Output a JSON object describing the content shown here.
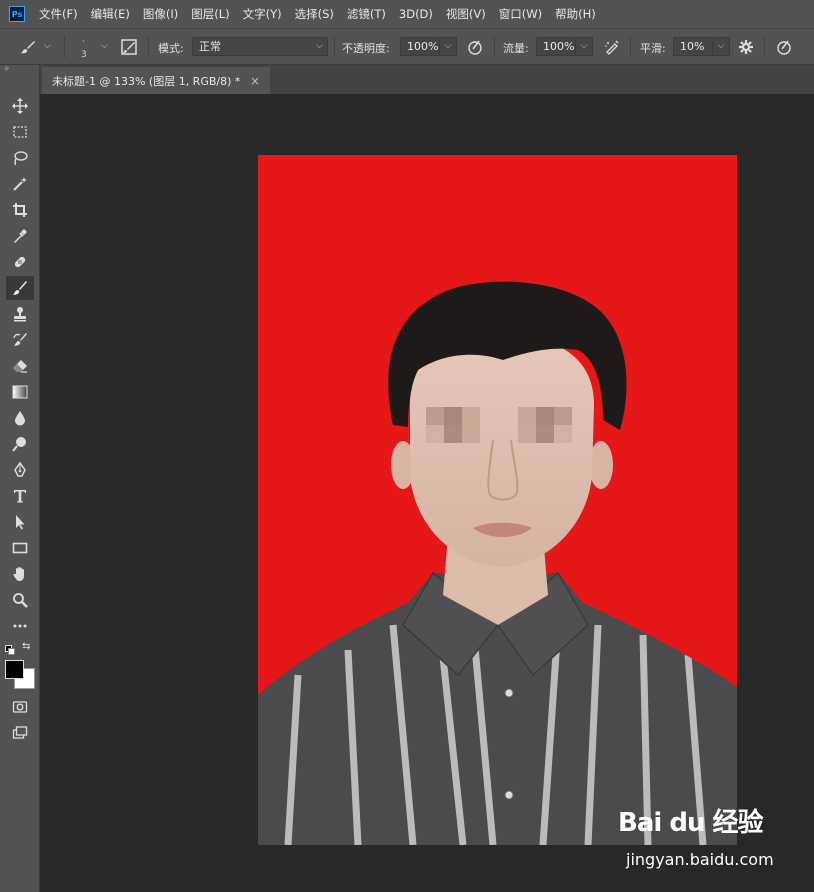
{
  "app": {
    "logo": "Ps"
  },
  "menu": [
    "文件(F)",
    "编辑(E)",
    "图像(I)",
    "图层(L)",
    "文字(Y)",
    "选择(S)",
    "滤镜(T)",
    "3D(D)",
    "视图(V)",
    "窗口(W)",
    "帮助(H)"
  ],
  "options": {
    "brush_size": "3",
    "mode_label": "模式:",
    "mode_value": "正常",
    "opacity_label": "不透明度:",
    "opacity_value": "100%",
    "flow_label": "流量:",
    "flow_value": "100%",
    "smoothing_label": "平滑:",
    "smoothing_value": "10%"
  },
  "document_tab": {
    "title": "未标题-1 @ 133% (图层 1, RGB/8) *",
    "close": "×"
  },
  "canvas": {
    "background_color": "#e61718"
  },
  "watermark": {
    "logo": "Bai du 经验",
    "url": "jingyan.baidu.com"
  },
  "tools": [
    "move-icon",
    "marquee-icon",
    "lasso-icon",
    "magic-wand-icon",
    "crop-icon",
    "eyedropper-icon",
    "healing-icon",
    "brush-icon",
    "stamp-icon",
    "history-brush-icon",
    "eraser-icon",
    "gradient-icon",
    "blur-icon",
    "dodge-icon",
    "pen-icon",
    "type-icon",
    "path-select-icon",
    "rectangle-icon",
    "hand-icon",
    "zoom-icon",
    "more-icon"
  ]
}
